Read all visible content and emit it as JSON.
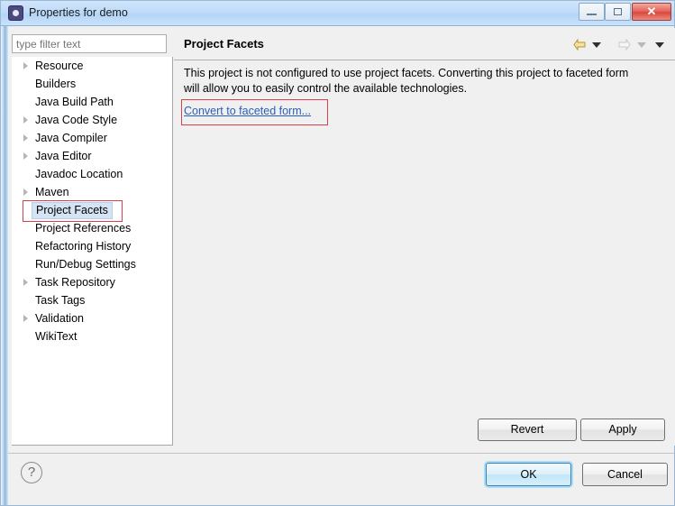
{
  "window": {
    "title": "Properties for demo",
    "icon": "properties-gear-icon",
    "controls": {
      "minimize": "minimize-icon",
      "maximize": "maximize-icon",
      "close": "✕"
    }
  },
  "filter": {
    "placeholder": "type filter text",
    "value": ""
  },
  "tree": {
    "items": [
      {
        "label": "Resource",
        "expandable": true,
        "selected": false
      },
      {
        "label": "Builders",
        "expandable": false,
        "selected": false
      },
      {
        "label": "Java Build Path",
        "expandable": false,
        "selected": false
      },
      {
        "label": "Java Code Style",
        "expandable": true,
        "selected": false
      },
      {
        "label": "Java Compiler",
        "expandable": true,
        "selected": false
      },
      {
        "label": "Java Editor",
        "expandable": true,
        "selected": false
      },
      {
        "label": "Javadoc Location",
        "expandable": false,
        "selected": false
      },
      {
        "label": "Maven",
        "expandable": true,
        "selected": false
      },
      {
        "label": "Project Facets",
        "expandable": false,
        "selected": true
      },
      {
        "label": "Project References",
        "expandable": false,
        "selected": false
      },
      {
        "label": "Refactoring History",
        "expandable": false,
        "selected": false
      },
      {
        "label": "Run/Debug Settings",
        "expandable": false,
        "selected": false
      },
      {
        "label": "Task Repository",
        "expandable": true,
        "selected": false
      },
      {
        "label": "Task Tags",
        "expandable": false,
        "selected": false
      },
      {
        "label": "Validation",
        "expandable": true,
        "selected": false
      },
      {
        "label": "WikiText",
        "expandable": false,
        "selected": false
      }
    ]
  },
  "content": {
    "title": "Project Facets",
    "description": "This project is not configured to use project facets. Converting this project to faceted form will allow you to easily control the available technologies.",
    "link_label": "Convert to faceted form...",
    "nav": {
      "back_icon": "back-arrow-icon",
      "back_menu_icon": "chevron-down-icon",
      "forward_icon": "forward-arrow-icon",
      "forward_menu_icon": "chevron-down-icon",
      "view_menu_icon": "chevron-down-icon"
    }
  },
  "buttons": {
    "revert": "Revert",
    "apply": "Apply",
    "ok": "OK",
    "cancel": "Cancel",
    "help": "?"
  },
  "annotations": {
    "color": "#d8404f",
    "highlighted_tree_item": "Project Facets",
    "highlighted_link": "Convert to faceted form..."
  }
}
